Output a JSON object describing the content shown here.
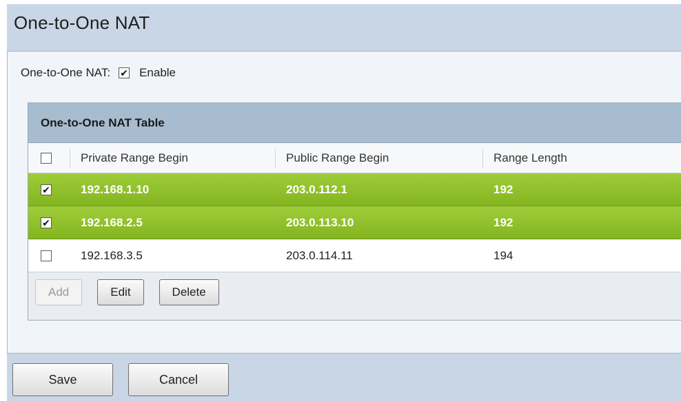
{
  "page": {
    "title": "One-to-One NAT"
  },
  "enable": {
    "label": "One-to-One NAT:",
    "checked": true,
    "option_label": "Enable"
  },
  "table": {
    "caption": "One-to-One NAT Table",
    "columns": [
      "Private Range Begin",
      "Public Range Begin",
      "Range Length"
    ],
    "rows": [
      {
        "selected": true,
        "private": "192.168.1.10",
        "public": "203.0.112.1",
        "length": "192"
      },
      {
        "selected": true,
        "private": "192.168.2.5",
        "public": "203.0.113.10",
        "length": "192"
      },
      {
        "selected": false,
        "private": "192.168.3.5",
        "public": "203.0.114.11",
        "length": "194"
      }
    ],
    "buttons": {
      "add": "Add",
      "edit": "Edit",
      "delete": "Delete"
    }
  },
  "footer": {
    "save": "Save",
    "cancel": "Cancel"
  },
  "colors": {
    "selected_row": "#8fc12b",
    "header_bg": "#a8bccf",
    "page_bg": "#c8d6e5"
  }
}
